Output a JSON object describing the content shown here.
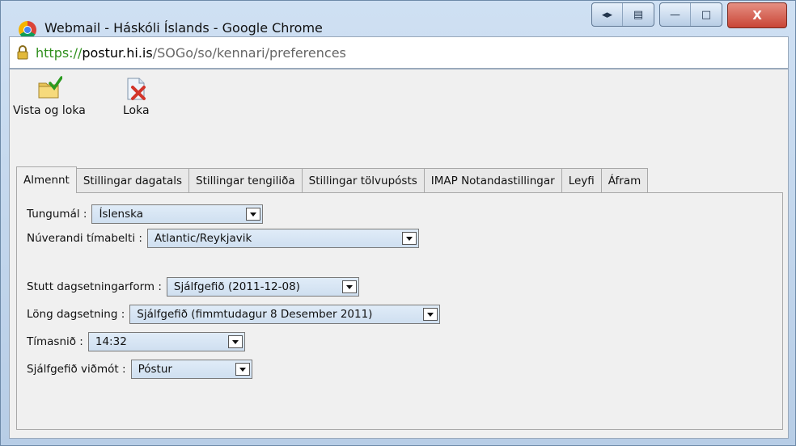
{
  "window": {
    "title": "Webmail - Háskóli Íslands - Google Chrome",
    "controls": {
      "minimize": "—",
      "maximize": "□",
      "close": "X"
    }
  },
  "url": {
    "scheme": "https://",
    "host": "postur.hi.is",
    "path": "/SOGo/so/kennari/preferences"
  },
  "toolbar": {
    "save_close_label": "Vista og loka",
    "close_label": "Loka"
  },
  "tabs": [
    {
      "label": "Almennt",
      "active": true
    },
    {
      "label": "Stillingar dagatals",
      "active": false
    },
    {
      "label": "Stillingar tengiliða",
      "active": false
    },
    {
      "label": "Stillingar tölvupósts",
      "active": false
    },
    {
      "label": "IMAP Notandastillingar",
      "active": false
    },
    {
      "label": "Leyfi",
      "active": false
    },
    {
      "label": "Áfram",
      "active": false
    }
  ],
  "form": {
    "language": {
      "label": "Tungumál :",
      "value": "Íslenska"
    },
    "timezone": {
      "label": "Núverandi tímabelti :",
      "value": "Atlantic/Reykjavik"
    },
    "short_date": {
      "label": "Stutt dagsetningarform :",
      "value": "Sjálfgefið (2011-12-08)"
    },
    "long_date": {
      "label": "Löng dagsetning :",
      "value": "Sjálfgefið (fimmtudagur 8 Desember 2011)"
    },
    "time_format": {
      "label": "Tímasnið :",
      "value": "14:32"
    },
    "default_module": {
      "label": "Sjálfgefið viðmót :",
      "value": "Póstur"
    }
  },
  "colors": {
    "url_scheme": "#2f8f1d",
    "select_bg": "#d6e5f5",
    "close_button": "#c94536"
  }
}
